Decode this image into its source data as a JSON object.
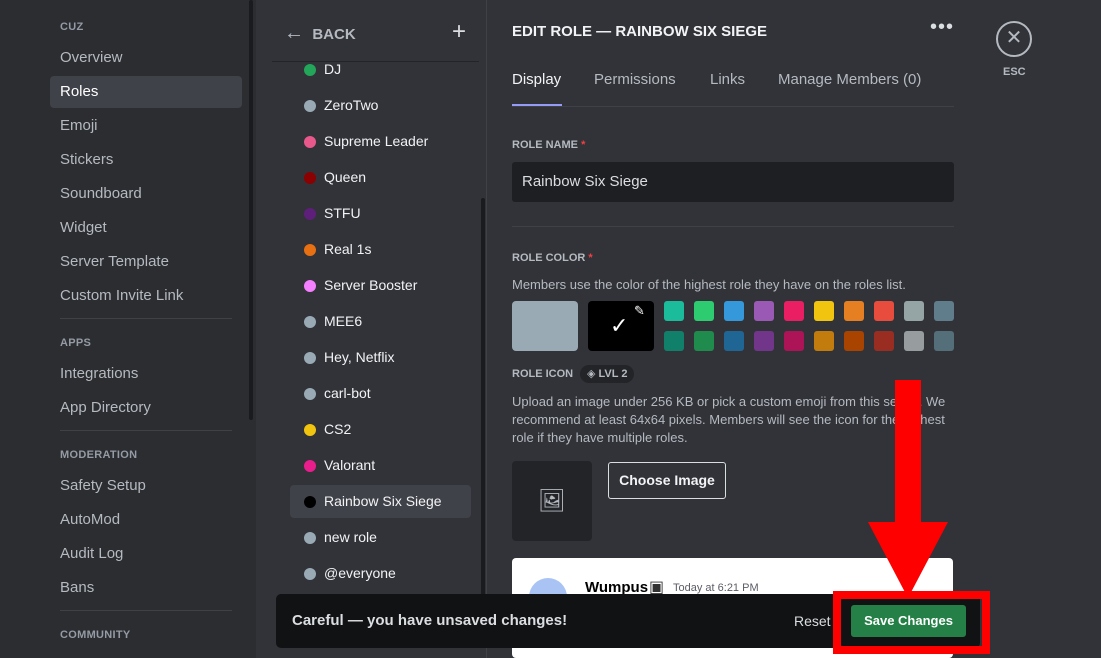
{
  "sidebar": {
    "sections": [
      {
        "header": "CUZ",
        "items": [
          "Overview",
          "Roles",
          "Emoji",
          "Stickers",
          "Soundboard",
          "Widget",
          "Server Template",
          "Custom Invite Link"
        ]
      },
      {
        "header": "APPS",
        "items": [
          "Integrations",
          "App Directory"
        ]
      },
      {
        "header": "MODERATION",
        "items": [
          "Safety Setup",
          "AutoMod",
          "Audit Log",
          "Bans"
        ]
      },
      {
        "header": "COMMUNITY",
        "items": []
      }
    ],
    "active": "Roles"
  },
  "roles": {
    "back_label": "BACK",
    "items": [
      {
        "name": "DJ",
        "color": "#23a55a"
      },
      {
        "name": "ZeroTwo",
        "color": "#99aab5"
      },
      {
        "name": "Supreme Leader",
        "color": "#e8588a"
      },
      {
        "name": "Queen",
        "color": "#8b0000"
      },
      {
        "name": "STFU",
        "color": "#5e1f7a"
      },
      {
        "name": "Real 1s",
        "color": "#e67012"
      },
      {
        "name": "Server Booster",
        "color": "#f47fff"
      },
      {
        "name": "MEE6",
        "color": "#99aab5"
      },
      {
        "name": "Hey, Netflix",
        "color": "#99aab5"
      },
      {
        "name": "carl-bot",
        "color": "#99aab5"
      },
      {
        "name": "CS2",
        "color": "#f1c40f"
      },
      {
        "name": "Valorant",
        "color": "#e91e8c"
      },
      {
        "name": "Rainbow Six Siege",
        "color": "#000000"
      },
      {
        "name": "new role",
        "color": "#99aab5"
      },
      {
        "name": "@everyone",
        "color": "#99aab5"
      }
    ],
    "selected": "Rainbow Six Siege"
  },
  "editor": {
    "title": "EDIT ROLE — RAINBOW SIX SIEGE",
    "tabs": [
      "Display",
      "Permissions",
      "Links",
      "Manage Members (0)"
    ],
    "role_name_label": "ROLE NAME",
    "role_name_value": "Rainbow Six Siege",
    "role_color_label": "ROLE COLOR",
    "role_color_desc": "Members use the color of the highest role they have on the roles list.",
    "default_color": "#99aab5",
    "custom_color": "#000000",
    "swatches_top": [
      "#1abc9c",
      "#2ecc71",
      "#3498db",
      "#9b59b6",
      "#e91e63",
      "#f1c40f",
      "#e67e22",
      "#e74c3c",
      "#95a5a6",
      "#607d8b"
    ],
    "swatches_bottom": [
      "#11806a",
      "#1f8b4c",
      "#206694",
      "#71368a",
      "#ad1457",
      "#c27c0e",
      "#a84300",
      "#992d22",
      "#979c9f",
      "#546e7a"
    ],
    "role_icon_label": "ROLE ICON",
    "level_badge": "LVL 2",
    "role_icon_desc": "Upload an image under 256 KB or pick a custom emoji from this server. We recommend at least 64x64 pixels. Members will see the icon for the highest role if they have multiple roles.",
    "choose_image": "Choose Image",
    "preview": {
      "username": "Wumpus",
      "timestamp": "Today at 6:21 PM"
    }
  },
  "close": {
    "label": "ESC"
  },
  "unsaved": {
    "message": "Careful — you have unsaved changes!",
    "reset": "Reset",
    "save": "Save Changes"
  },
  "annotation_color": "#ff0000"
}
